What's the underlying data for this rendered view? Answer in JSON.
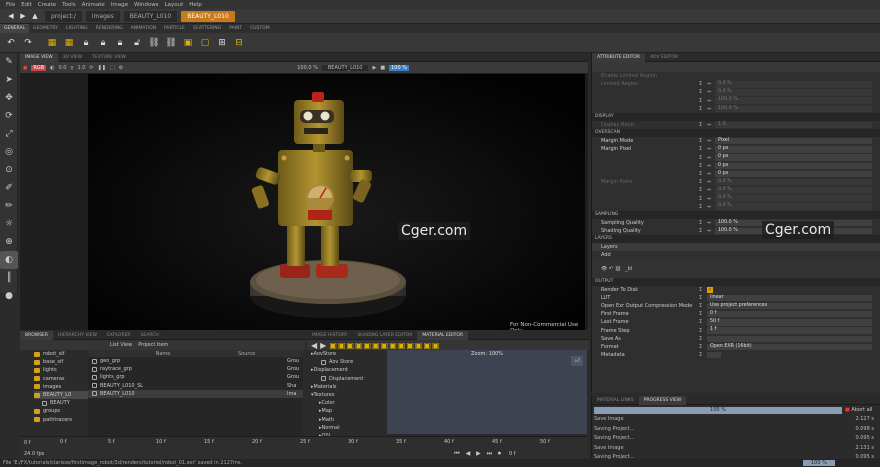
{
  "menu": [
    "File",
    "Edit",
    "Create",
    "Tools",
    "Animate",
    "Image",
    "Windows",
    "Layout",
    "Help"
  ],
  "breadcrumb": [
    "project:/",
    "images",
    "BEAUTY_L010",
    "BEAUTY_L010"
  ],
  "workspace_tabs": [
    "GENERAL",
    "GEOMETRY",
    "LIGHTING",
    "RENDERING",
    "ANIMATION",
    "PARTICLE",
    "SCATTERING",
    "PAINT",
    "CUSTOM"
  ],
  "viewport": {
    "tabs": [
      "IMAGE VIEW",
      "3D VIEW",
      "TEXTURE VIEW"
    ],
    "toolbar": {
      "exposure": "0.0",
      "gamma": "1.0",
      "zoom": "100.0 %",
      "image": "BEAUTY_L010",
      "percent": "100 %"
    },
    "watermark_left": "Cger.com",
    "watermark_right": "Cger.com",
    "noncommercial": "For Non-Commercial Use Only"
  },
  "attribute_editor": {
    "tabs": [
      "ATTRIBUTE EDITOR",
      "AOV EDITOR"
    ],
    "top_rows": [
      {
        "label": "Enable Limited Region",
        "value": ""
      },
      {
        "label": "Limited Region",
        "value": "0.0 %"
      },
      {
        "label": "",
        "value": "0.0 %"
      },
      {
        "label": "",
        "value": "100.0 %"
      },
      {
        "label": "",
        "value": "100.0 %"
      }
    ],
    "display": {
      "header": "DISPLAY",
      "rows": [
        {
          "label": "Display Ratio",
          "value": "1.0"
        }
      ]
    },
    "overscan": {
      "header": "OVERSCAN",
      "rows": [
        {
          "label": "Margin Mode",
          "value": "Pixel"
        },
        {
          "label": "Margin Pixel",
          "value": "0 px"
        },
        {
          "label": "",
          "value": "0 px"
        },
        {
          "label": "",
          "value": "0 px"
        },
        {
          "label": "",
          "value": "0 px"
        },
        {
          "label": "Margin Ratio",
          "value": "0.0 %"
        },
        {
          "label": "",
          "value": "0.0 %"
        },
        {
          "label": "",
          "value": "0.0 %"
        },
        {
          "label": "",
          "value": "0.0 %"
        }
      ]
    },
    "sampling": {
      "header": "SAMPLING",
      "rows": [
        {
          "label": "Sampling Quality",
          "value": "100.0 %"
        },
        {
          "label": "Shading Quality",
          "value": "100.0 %"
        }
      ]
    },
    "layers": {
      "header": "LAYERS",
      "sub": "Layers",
      "add": "Add",
      "layer_name": "_bl"
    },
    "output": {
      "header": "OUTPUT",
      "rows": [
        {
          "label": "Render To Disk",
          "value": ""
        },
        {
          "label": "LUT",
          "value": "linear"
        },
        {
          "label": "Open Exr Output Compression Mode",
          "value": "Use project preferences"
        },
        {
          "label": "First Frame",
          "value": "0 f"
        },
        {
          "label": "Last Frame",
          "value": "50 f"
        },
        {
          "label": "Frame Step",
          "value": "1 f"
        },
        {
          "label": "Save As",
          "value": ""
        },
        {
          "label": "Format",
          "value": "Open EXR (16bit)"
        },
        {
          "label": "Metadata",
          "value": ""
        }
      ]
    }
  },
  "browser": {
    "tabs": [
      "BROWSER",
      "HIERARCHY VIEW",
      "EXPLORER",
      "SEARCH"
    ],
    "list_view": "List View",
    "project_item": "Project Item",
    "tree": [
      "robot_sif",
      "base_sif",
      "lights",
      "cameras",
      "images",
      "BEAUTY_L0",
      "BEAUTY",
      "groups",
      "pathtracers"
    ],
    "columns": [
      "Name",
      "Source"
    ],
    "rows": [
      {
        "name": "geo_grp",
        "source": "Grou"
      },
      {
        "name": "raytrace_grp",
        "source": "Grou"
      },
      {
        "name": "lights_grp",
        "source": "Grou"
      },
      {
        "name": "BEAUTY_L010_SL",
        "source": "Sha"
      },
      {
        "name": "BEAUTY_L010",
        "source": "Ima"
      }
    ]
  },
  "material_editor": {
    "tabs": [
      "IMAGE HISTORY",
      "SHADING LAYER EDITOR",
      "MATERIAL EDITOR"
    ],
    "zoom": "Zoom: 100%",
    "tree": [
      "AovStore",
      "Aov Store",
      "Displacement",
      "Displacement",
      "Materials",
      "Textures",
      "Color",
      "Map",
      "Math",
      "Normal",
      "OSL"
    ]
  },
  "progress": {
    "tabs": [
      "MATERIAL LINKS",
      "PROGRESS VIEW"
    ],
    "bar_label": "100 %",
    "bar_fraction": 1.0,
    "abort": "Abort all",
    "rows": [
      {
        "label": "Save Image",
        "value": "2.127 s"
      },
      {
        "label": "Saving Project...",
        "value": "0.098 s"
      },
      {
        "label": "Saving Project...",
        "value": "0.095 s"
      },
      {
        "label": "Save Image",
        "value": "2.131 s"
      },
      {
        "label": "Saving Project...",
        "value": "0.095 s"
      }
    ],
    "status_percent": "100 %"
  },
  "timeline": {
    "ticks": [
      "0 f",
      "5 f",
      "10 f",
      "15 f",
      "20 f",
      "25 f",
      "30 f",
      "35 f",
      "40 f",
      "45 f",
      "50 f"
    ],
    "start": "0 f",
    "end": "50 f",
    "current": "0 f",
    "fps": "24.0 fps"
  },
  "status": "File 'E:/FX/tutorials/clarisse/firstimage_robot/3d/renders/tutoriel/robot_01.exr' saved in 2127ms."
}
